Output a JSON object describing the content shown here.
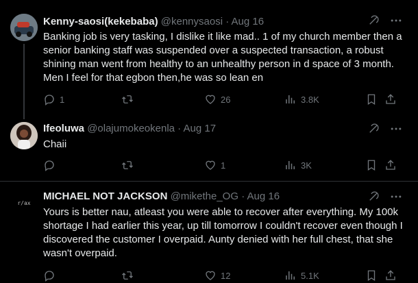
{
  "tweets": [
    {
      "name": "Kenny-saosi(kekebaba)",
      "handle": "@kennysaosi",
      "sep": "·",
      "date": "Aug 16",
      "text": "Banking job is very tasking, I dislike it like mad.. 1 of my church member then a senior banking staff was suspended over a suspected transaction, a robust shining man went from healthy to an unhealthy person in d space of 3 month. Men I feel for that egbon then,he was so lean en",
      "replies": "1",
      "retweets": "",
      "likes": "26",
      "views": "3.8K"
    },
    {
      "name": "Ifeoluwa",
      "handle": "@olajumokeokenla",
      "sep": "·",
      "date": "Aug 17",
      "text": "Chaii",
      "replies": "",
      "retweets": "",
      "likes": "1",
      "views": "3K"
    },
    {
      "name": "MICHAEL NOT JACKSON",
      "handle": "@mikethe_OG",
      "sep": "·",
      "date": "Aug 16",
      "text": "Yours is better nau, atleast you were able to recover after everything. My 100k shortage I had earlier this year, up till tomorrow I couldn't recover even though I discovered the customer I overpaid. Aunty denied with her full chest, that she wasn't overpaid.",
      "avatar_text": "r/ax",
      "replies": "",
      "retweets": "",
      "likes": "12",
      "views": "5.1K"
    }
  ],
  "icons": {
    "grok": "grok-icon",
    "more": "more-icon",
    "reply": "reply-icon",
    "retweet": "retweet-icon",
    "like": "like-icon",
    "views": "views-icon",
    "bookmark": "bookmark-icon",
    "share": "share-icon"
  },
  "colors": {
    "background": "#000000",
    "text": "#e7e9ea",
    "muted": "#71767b",
    "divider": "#2f3336"
  }
}
